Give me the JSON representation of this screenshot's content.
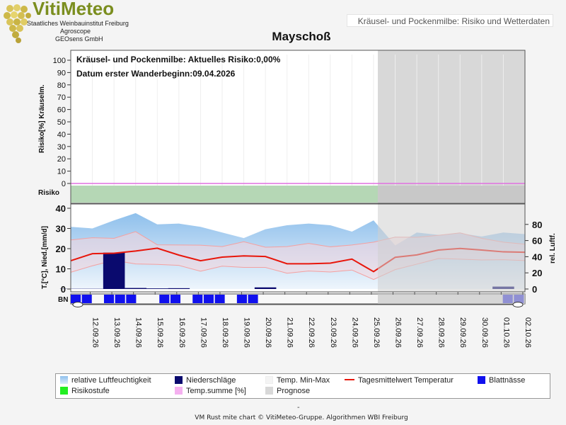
{
  "logo": {
    "title": "VitiMeteo",
    "line1": "Staatliches Weinbauinstitut Freiburg",
    "line2": "Agroscope",
    "line3": "GEOsens GmbH"
  },
  "header": {
    "subtitle": "Kräusel- und Pockenmilbe: Risiko und Wetterdaten",
    "station": "Mayschoß"
  },
  "chart_data": {
    "type": "line",
    "top_panel": {
      "text_risk": "Kräusel- und Pockenmilbe: Aktuelles Risiko:0,00%",
      "text_date": "Datum  erster Wanderbeginn:09.04.2026",
      "ylabel": "Risiko[%] Kräuselm.",
      "yticks": [
        "100",
        "90",
        "80",
        "70",
        "60",
        "50",
        "40",
        "30",
        "20",
        "10",
        "0"
      ],
      "ylim": [
        0,
        100
      ],
      "risk_row_label": "Risiko",
      "risk_level": "green",
      "temp_sum_values": [
        0,
        0,
        0,
        0,
        0,
        0,
        0,
        0,
        0,
        0,
        0,
        0,
        0,
        0,
        0,
        0,
        0,
        0,
        0,
        0,
        0
      ]
    },
    "bottom_panel": {
      "ylabel_left": "T.[°C], Nied.[mm/d]",
      "ylabel_right": "rel. Luftf.",
      "yticks_left": [
        "40",
        "30",
        "20",
        "10",
        "0"
      ],
      "ylim_left": [
        0,
        40
      ],
      "yticks_right": [
        "80",
        "60",
        "40",
        "20",
        "0"
      ],
      "ylim_right": [
        0,
        100
      ],
      "bn_label": "BN",
      "dates": [
        "12.09.26",
        "13.09.26",
        "14.09.26",
        "15.09.26",
        "16.09.26",
        "17.09.26",
        "18.09.26",
        "19.09.26",
        "20.09.26",
        "21.09.26",
        "22.09.26",
        "23.09.26",
        "24.09.26",
        "25.09.26",
        "26.09.26",
        "27.09.26",
        "28.09.26",
        "29.09.26",
        "30.09.26",
        "01.10.26",
        "02.10.26"
      ],
      "forecast_start": "25.09.26",
      "series": [
        {
          "name": "Tagesmittelwert Temperatur",
          "color": "#e8160b",
          "values": [
            14.0,
            17.5,
            17.7,
            18.8,
            20.2,
            16.8,
            14.0,
            15.8,
            16.4,
            16.1,
            12.5,
            12.5,
            12.8,
            14.8,
            8.6,
            15.7,
            16.9,
            19.3,
            20.1,
            19.3,
            18.4,
            18.2
          ]
        },
        {
          "name": "Temp. Min-Max (max)",
          "color": "#f4a0a0",
          "values": [
            24.3,
            25.4,
            25.1,
            28.4,
            21.9,
            21.8,
            21.7,
            21.0,
            23.4,
            20.7,
            21.0,
            22.6,
            20.9,
            21.8,
            23.2,
            25.7,
            25.6,
            26.6,
            27.8,
            25.1,
            23.2,
            22.2
          ]
        },
        {
          "name": "Temp. Min-Max (min)",
          "color": "#f4a0a0",
          "values": [
            8.3,
            11.5,
            14.2,
            12.4,
            12.2,
            11.7,
            8.8,
            11.3,
            10.7,
            10.7,
            7.8,
            8.9,
            8.4,
            9.4,
            4.7,
            9.6,
            12.3,
            15.1,
            14.8,
            14.4,
            14.5,
            14.1
          ]
        },
        {
          "name": "relative Luftfeuchtigkeit",
          "color": "#a8cdf0",
          "values": [
            77,
            75,
            85,
            94,
            80,
            81,
            77,
            70,
            63,
            74,
            79,
            81,
            79,
            71,
            85,
            54,
            70,
            67,
            69,
            65,
            70,
            68
          ]
        },
        {
          "name": "Niederschläge",
          "color": "#0a0a6e",
          "values": [
            0.1,
            0.1,
            18.0,
            0.5,
            0.3,
            0.4,
            0.0,
            0.0,
            0.0,
            0.8,
            0.0,
            0.0,
            0.0,
            0.0,
            0.0,
            0.0,
            0.0,
            0.0,
            0.0,
            0.0,
            1.2,
            0.0
          ]
        }
      ],
      "leaf_wetness": [
        1,
        1,
        0,
        1,
        1,
        1,
        0,
        0,
        1,
        1,
        0,
        1,
        1,
        1,
        0,
        1,
        1,
        0,
        0,
        0,
        0,
        0,
        0,
        0,
        0,
        0,
        0,
        0,
        0,
        0,
        0,
        0,
        0,
        0,
        0,
        0,
        0,
        0,
        0,
        1,
        1
      ]
    }
  },
  "legend": {
    "items": [
      {
        "label": "relative Luftfeuchtigkeit",
        "color": "#a8cdf0",
        "kind": "box"
      },
      {
        "label": "Niederschläge",
        "color": "#0a0a6e",
        "kind": "box"
      },
      {
        "label": "Temp. Min-Max",
        "color": "#f4f4f4",
        "kind": "box"
      },
      {
        "label": "Tagesmittelwert Temperatur",
        "color": "#e8160b",
        "kind": "line"
      },
      {
        "label": "Blattnässe",
        "color": "#1010ee",
        "kind": "box"
      },
      {
        "label": "Risikostufe",
        "color": "#22ee22",
        "kind": "box"
      },
      {
        "label": "Temp.summe [%]",
        "color": "#f5b0f0",
        "kind": "box"
      },
      {
        "label": "Prognose",
        "color": "#d8d8d8",
        "kind": "box"
      }
    ]
  },
  "footer": {
    "dash": "-",
    "text": "VM Rust mite chart © VitiMeteo-Gruppe. Algorithmen WBI Freiburg"
  }
}
